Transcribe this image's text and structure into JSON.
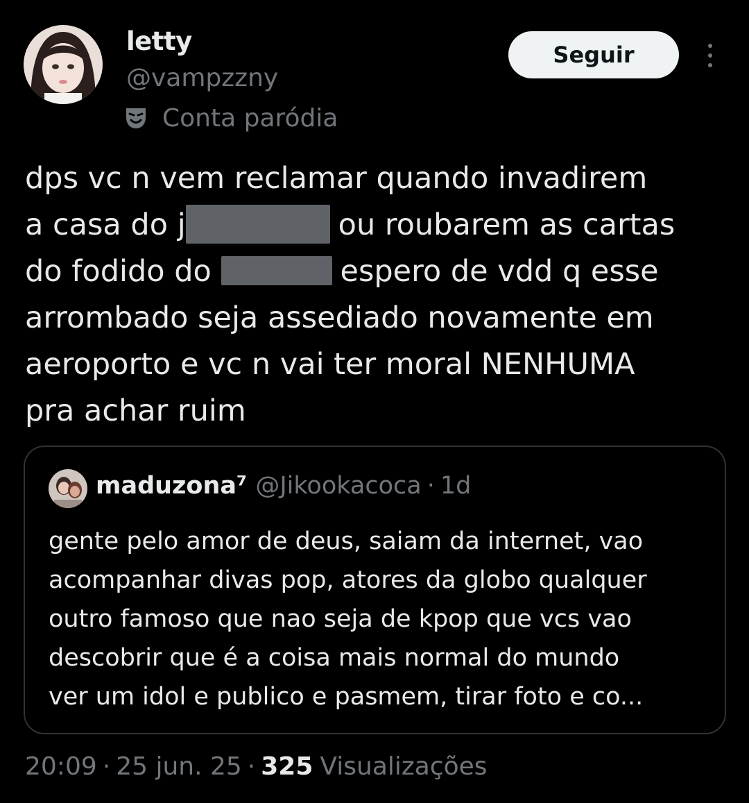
{
  "author": {
    "display_name": "letty",
    "handle": "@vampzzny",
    "parody_label": "Conta paródia",
    "parody_icon": "theater-mask-icon"
  },
  "actions": {
    "follow_label": "Seguir",
    "more_icon": "more-vertical-icon"
  },
  "tweet": {
    "lines": [
      {
        "text": "dps vc n vem reclamar quando invadirem"
      },
      {
        "before": "a casa do j",
        "after": "ou roubarem as cartas"
      },
      {
        "before": "do fodido do",
        "after": "espero de vdd q esse"
      },
      {
        "text": "arrombado seja assediado novamente em"
      },
      {
        "text": "aeroporto e vc n vai ter moral NENHUMA"
      },
      {
        "text": "pra achar ruim"
      }
    ]
  },
  "quote": {
    "display_name": "maduzona⁷",
    "handle": "@Jikookacoca",
    "separator": "·",
    "time": "1d",
    "lines": [
      "gente pelo amor de deus, saiam da internet, vao",
      "acompanhar divas pop, atores da globo qualquer",
      "outro famoso que nao seja de kpop que vcs vao",
      "descobrir que é a coisa mais normal do mundo",
      "ver um idol e publico e pasmem, tirar foto e co..."
    ]
  },
  "meta": {
    "time": "20:09",
    "separator": "·",
    "date": "25 jun. 25",
    "views_count": "325",
    "views_label": "Visualizações"
  },
  "colors": {
    "background": "#000000",
    "text": "#e7e9ea",
    "secondary": "#71767b",
    "border": "#2f3336",
    "follow_bg": "#eff3f4",
    "redaction": "#5f6368"
  }
}
